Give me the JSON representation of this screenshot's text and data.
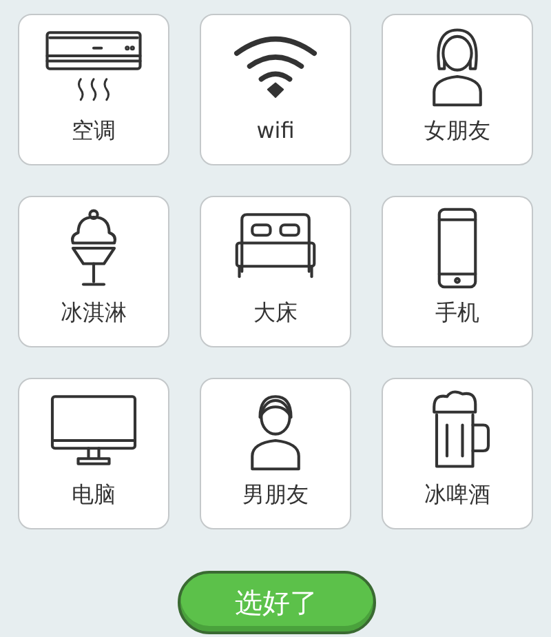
{
  "items": [
    {
      "kind": "ac",
      "label": "空调"
    },
    {
      "kind": "wifi",
      "label": "wifi"
    },
    {
      "kind": "girl",
      "label": "女朋友"
    },
    {
      "kind": "icecream",
      "label": "冰淇淋"
    },
    {
      "kind": "bed",
      "label": "大床"
    },
    {
      "kind": "phone",
      "label": "手机"
    },
    {
      "kind": "monitor",
      "label": "电脑"
    },
    {
      "kind": "boy",
      "label": "男朋友"
    },
    {
      "kind": "beer",
      "label": "冰啤酒"
    }
  ],
  "button": "选好了"
}
